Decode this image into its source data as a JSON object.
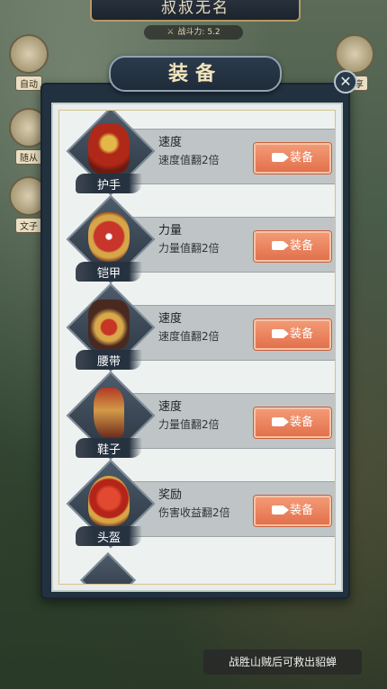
{
  "header": {
    "player_name": "叔叔无名",
    "power_label": "战斗力: 5.2"
  },
  "side_buttons": [
    "自动",
    "随从",
    "文子",
    "分享"
  ],
  "panel": {
    "title": "装备",
    "close_icon": "✕"
  },
  "equipment": [
    {
      "slot": "护手",
      "name": "速度",
      "desc": "速度值翻2倍",
      "button": "装备",
      "icon": "gauntlet-icon"
    },
    {
      "slot": "铠甲",
      "name": "力量",
      "desc": "力量值翻2倍",
      "button": "装备",
      "icon": "armor-icon"
    },
    {
      "slot": "腰带",
      "name": "速度",
      "desc": "速度值翻2倍",
      "button": "装备",
      "icon": "belt-icon"
    },
    {
      "slot": "鞋子",
      "name": "速度",
      "desc": "力量值翻2倍",
      "button": "装备",
      "icon": "boots-icon"
    },
    {
      "slot": "头盔",
      "name": "奖励",
      "desc": "伤害收益翻2倍",
      "button": "装备",
      "icon": "helmet-icon"
    }
  ],
  "toast": "战胜山贼后可救出貂蝉"
}
